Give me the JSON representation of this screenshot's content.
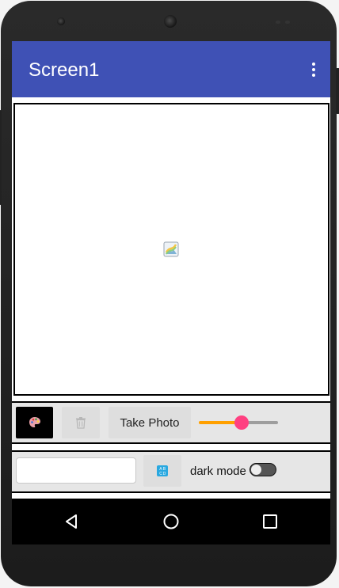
{
  "app_bar": {
    "title": "Screen1",
    "color": "#3f51b5",
    "menu_icon": "overflow-menu-icon"
  },
  "canvas": {
    "placeholder_icon": "image-placeholder-icon"
  },
  "toolbar": {
    "palette_icon": "palette-icon",
    "trash_icon": "trash-icon",
    "take_photo_label": "Take Photo",
    "slider": {
      "value_fraction": 0.54,
      "active_color": "#ffa000",
      "thumb_color": "#ff4081"
    }
  },
  "bottom_row": {
    "text_input_value": "",
    "text_input_placeholder": "",
    "text_to_speech_icon": "abc-text-icon",
    "dark_mode_label": "dark mode",
    "dark_mode_on": false
  },
  "nav_bar": {
    "back_icon": "back-triangle-icon",
    "home_icon": "home-circle-icon",
    "recent_icon": "recents-square-icon"
  }
}
